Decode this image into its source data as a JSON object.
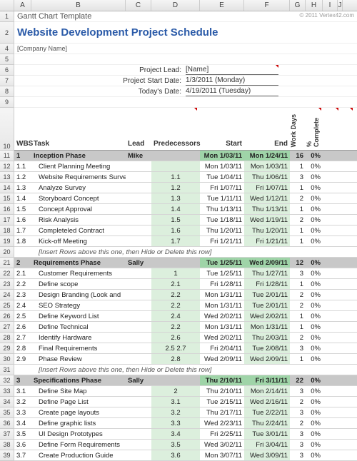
{
  "columns": [
    "A",
    "B",
    "C",
    "D",
    "E",
    "F",
    "G",
    "H",
    "I",
    "J"
  ],
  "template_name": "Gantt Chart Template",
  "copyright": "© 2011 Vertex42.com",
  "title": "Website Development Project Schedule",
  "company": "[Company Name]",
  "info": {
    "lead_label": "Project Lead:",
    "lead_val": "[Name]",
    "start_label": "Project Start Date:",
    "start_val": "1/3/2011 (Monday)",
    "today_label": "Today's Date:",
    "today_val": "4/19/2011 (Tuesday)"
  },
  "headers": {
    "wbs": "WBS",
    "task": "Task",
    "lead": "Lead",
    "pred": "Predecessors",
    "start": "Start",
    "end": "End",
    "wd": "Work Days",
    "pc": "% Complete"
  },
  "hint_text": "[Insert Rows above this one, then Hide or Delete this row]",
  "phases": [
    {
      "wbs": "1",
      "task": "Inception Phase",
      "lead": "Mike",
      "start": "Mon 1/03/11",
      "end": "Mon 1/24/11",
      "wd": "16",
      "pc": "0%",
      "rows": [
        {
          "wbs": "1.1",
          "task": "Client Planning Meeting",
          "pred": "",
          "start": "Mon 1/03/11",
          "end": "Mon 1/03/11",
          "wd": "1",
          "pc": "0%"
        },
        {
          "wbs": "1.2",
          "task": "Website Requirements Survey",
          "pred": "1.1",
          "start": "Tue 1/04/11",
          "end": "Thu 1/06/11",
          "wd": "3",
          "pc": "0%"
        },
        {
          "wbs": "1.3",
          "task": "Analyze Survey",
          "pred": "1.2",
          "start": "Fri 1/07/11",
          "end": "Fri 1/07/11",
          "wd": "1",
          "pc": "0%"
        },
        {
          "wbs": "1.4",
          "task": "Storyboard Concept",
          "pred": "1.3",
          "start": "Tue 1/11/11",
          "end": "Wed 1/12/11",
          "wd": "2",
          "pc": "0%"
        },
        {
          "wbs": "1.5",
          "task": "Concept Approval",
          "pred": "1.4",
          "start": "Thu 1/13/11",
          "end": "Thu 1/13/11",
          "wd": "1",
          "pc": "0%"
        },
        {
          "wbs": "1.6",
          "task": "Risk Analysis",
          "pred": "1.5",
          "start": "Tue 1/18/11",
          "end": "Wed 1/19/11",
          "wd": "2",
          "pc": "0%"
        },
        {
          "wbs": "1.7",
          "task": "Completeled Contract",
          "pred": "1.6",
          "start": "Thu 1/20/11",
          "end": "Thu 1/20/11",
          "wd": "1",
          "pc": "0%"
        },
        {
          "wbs": "1.8",
          "task": "Kick-off Meeting",
          "pred": "1.7",
          "start": "Fri 1/21/11",
          "end": "Fri 1/21/11",
          "wd": "1",
          "pc": "0%"
        }
      ]
    },
    {
      "wbs": "2",
      "task": "Requirements Phase",
      "lead": "Sally",
      "start": "Tue 1/25/11",
      "end": "Wed 2/09/11",
      "wd": "12",
      "pc": "0%",
      "rows": [
        {
          "wbs": "2.1",
          "task": "Customer Requirements",
          "pred": "1",
          "start": "Tue 1/25/11",
          "end": "Thu 1/27/11",
          "wd": "3",
          "pc": "0%"
        },
        {
          "wbs": "2.2",
          "task": "Define scope",
          "pred": "2.1",
          "start": "Fri 1/28/11",
          "end": "Fri 1/28/11",
          "wd": "1",
          "pc": "0%"
        },
        {
          "wbs": "2.3",
          "task": "Design Branding (Look and",
          "pred": "2.2",
          "start": "Mon 1/31/11",
          "end": "Tue 2/01/11",
          "wd": "2",
          "pc": "0%"
        },
        {
          "wbs": "2.4",
          "task": "SEO Strategy",
          "pred": "2.2",
          "start": "Mon 1/31/11",
          "end": "Tue 2/01/11",
          "wd": "2",
          "pc": "0%"
        },
        {
          "wbs": "2.5",
          "task": "Define Keyword List",
          "pred": "2.4",
          "start": "Wed 2/02/11",
          "end": "Wed 2/02/11",
          "wd": "1",
          "pc": "0%"
        },
        {
          "wbs": "2.6",
          "task": "Define Technical",
          "pred": "2.2",
          "start": "Mon 1/31/11",
          "end": "Mon 1/31/11",
          "wd": "1",
          "pc": "0%"
        },
        {
          "wbs": "2.7",
          "task": "Identify Hardware",
          "pred": "2.6",
          "start": "Wed 2/02/11",
          "end": "Thu 2/03/11",
          "wd": "2",
          "pc": "0%"
        },
        {
          "wbs": "2.8",
          "task": "Final Requirements",
          "pred": "2.5    2.7",
          "start": "Fri 2/04/11",
          "end": "Tue 2/08/11",
          "wd": "3",
          "pc": "0%"
        },
        {
          "wbs": "2.9",
          "task": "Phase Review",
          "pred": "2.8",
          "start": "Wed 2/09/11",
          "end": "Wed 2/09/11",
          "wd": "1",
          "pc": "0%"
        }
      ]
    },
    {
      "wbs": "3",
      "task": "Specifications Phase",
      "lead": "Sally",
      "start": "Thu 2/10/11",
      "end": "Fri 3/11/11",
      "wd": "22",
      "pc": "0%",
      "rows": [
        {
          "wbs": "3.1",
          "task": "Define Site Map",
          "pred": "2",
          "start": "Thu 2/10/11",
          "end": "Mon 2/14/11",
          "wd": "3",
          "pc": "0%"
        },
        {
          "wbs": "3.2",
          "task": "Define Page List",
          "pred": "3.1",
          "start": "Tue 2/15/11",
          "end": "Wed 2/16/11",
          "wd": "2",
          "pc": "0%"
        },
        {
          "wbs": "3.3",
          "task": "Create page layouts",
          "pred": "3.2",
          "start": "Thu 2/17/11",
          "end": "Tue 2/22/11",
          "wd": "3",
          "pc": "0%"
        },
        {
          "wbs": "3.4",
          "task": "Define graphic lists",
          "pred": "3.3",
          "start": "Wed 2/23/11",
          "end": "Thu 2/24/11",
          "wd": "2",
          "pc": "0%"
        },
        {
          "wbs": "3.5",
          "task": "UI Design Prototypes",
          "pred": "3.4",
          "start": "Fri 2/25/11",
          "end": "Tue 3/01/11",
          "wd": "3",
          "pc": "0%"
        },
        {
          "wbs": "3.6",
          "task": "Define Form Requirements",
          "pred": "3.5",
          "start": "Wed 3/02/11",
          "end": "Fri 3/04/11",
          "wd": "3",
          "pc": "0%"
        },
        {
          "wbs": "3.7",
          "task": "Create Production Guide",
          "pred": "3.6",
          "start": "Mon 3/07/11",
          "end": "Wed 3/09/11",
          "wd": "3",
          "pc": "0%"
        }
      ]
    }
  ]
}
